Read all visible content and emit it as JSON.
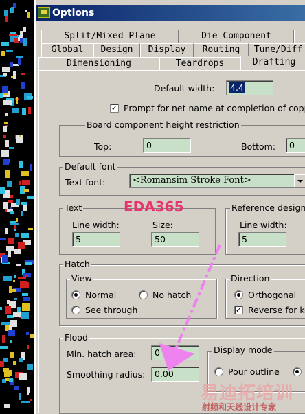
{
  "window": {
    "title": "Options"
  },
  "tabs": {
    "row1": [
      "Split/Mixed Plane",
      "Die Component"
    ],
    "row2": [
      "Global",
      "Design",
      "Display",
      "Routing",
      "Tune/Diff"
    ],
    "row3": [
      "Dimensioning",
      "Teardrops",
      "Drafting"
    ]
  },
  "drafting": {
    "default_width_label": "Default width:",
    "default_width_value": "4.4",
    "prompt_netname_label": "Prompt for net name at completion of copper",
    "prompt_netname_checked": true,
    "board_height": {
      "title": "Board component height restriction",
      "top_label": "Top:",
      "top_value": "0",
      "bottom_label": "Bottom:",
      "bottom_value": "0"
    },
    "default_font": {
      "title": "Default font",
      "text_font_label": "Text font:",
      "text_font_value": "<Romansim Stroke Font>"
    },
    "text": {
      "title": "Text",
      "line_width_label": "Line width:",
      "line_width_value": "5",
      "size_label": "Size:",
      "size_value": "50"
    },
    "reference_designator": {
      "title": "Reference design",
      "line_width_label": "Line width:",
      "line_width_value": "5"
    },
    "hatch": {
      "title": "Hatch",
      "view": {
        "title": "View",
        "normal": "Normal",
        "no_hatch": "No hatch",
        "see_through": "See through",
        "selected": "Normal"
      },
      "direction": {
        "title": "Direction",
        "orthogonal": "Orthogonal",
        "reverse": "Reverse for ke",
        "reverse_checked": true
      }
    },
    "flood": {
      "title": "Flood",
      "min_hatch_label": "Min. hatch area:",
      "min_hatch_value": "0",
      "smoothing_label": "Smoothing radius:",
      "smoothing_value": "0.00",
      "display_mode": {
        "title": "Display mode",
        "pour_outline": "Pour outline"
      }
    }
  },
  "annotations": {
    "brand": "EDA365",
    "watermark_cn": "易迪拓培训",
    "watermark_sub": "射频和天线设计专家"
  },
  "colors": {
    "field_bg": "#c8e0c8",
    "title_bar": "#0a246a",
    "annotation_arrow": "#ee82ee",
    "brand": "#e8346e"
  }
}
